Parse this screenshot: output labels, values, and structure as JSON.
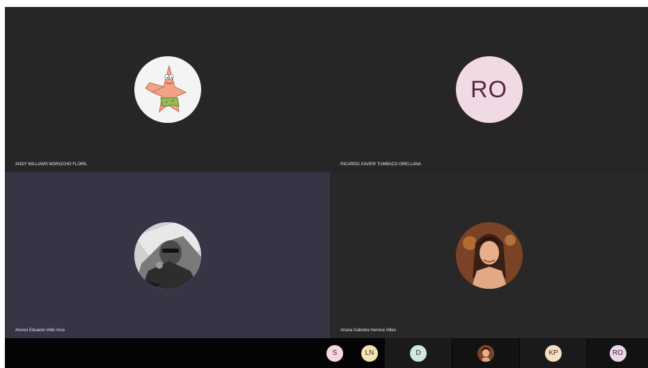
{
  "participants": [
    {
      "name": "ANDY WILLIAMS MOROCHO FLORIL",
      "avatar": "patrick-star-icon"
    },
    {
      "name": "RICARDO XAVIER TUMBACO ORELLANA",
      "initials": "RO",
      "color": "#f0dbe4"
    },
    {
      "name": "Alonso Eduardo Véliz Arce",
      "avatar": "bw-photo"
    },
    {
      "name": "Ariana Gabriela Herrera Villao",
      "avatar": "woman-photo"
    }
  ],
  "tray": [
    {
      "initials": "S",
      "color": "#f6d7dc"
    },
    {
      "initials": "LN",
      "color": "#f3e3b0"
    },
    {
      "initials": "D",
      "color": "#cfe8df"
    },
    {
      "initials": "",
      "avatar": "woman-photo"
    },
    {
      "initials": "KP",
      "color": "#f7dfbf"
    },
    {
      "initials": "RO",
      "color": "#eed6e8"
    }
  ]
}
